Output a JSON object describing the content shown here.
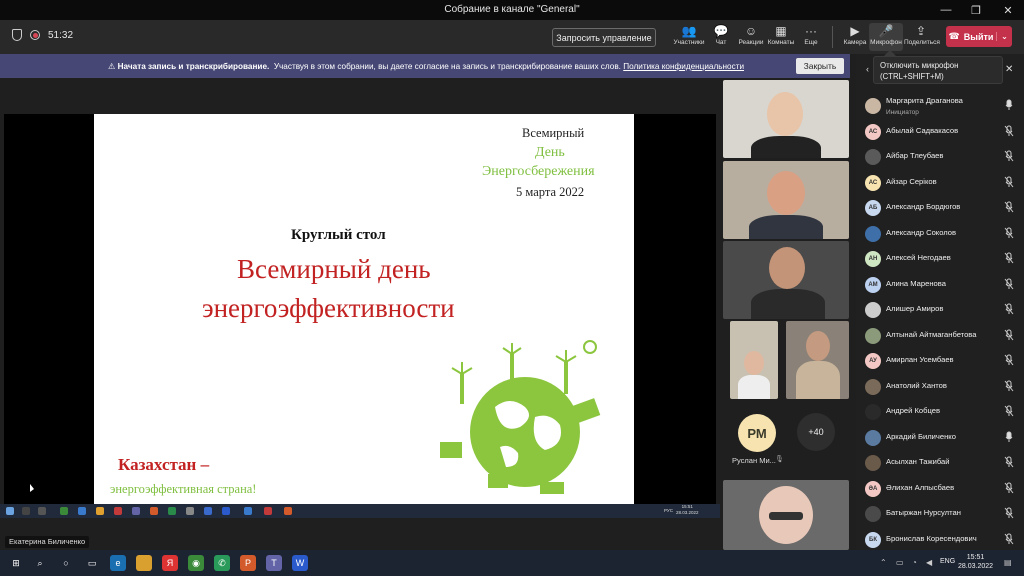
{
  "window": {
    "title": "Собрание в канале \"General\""
  },
  "toolbar": {
    "timer": "51:32",
    "request_control": "Запросить управление",
    "buttons": [
      {
        "label": "Участники",
        "icon": "people-icon"
      },
      {
        "label": "Чат",
        "icon": "chat-icon"
      },
      {
        "label": "Реакции",
        "icon": "reactions-icon"
      },
      {
        "label": "Комнаты",
        "icon": "rooms-icon"
      },
      {
        "label": "Еще",
        "icon": "more-icon"
      },
      {
        "label": "Камера",
        "icon": "camera-icon"
      },
      {
        "label": "Микрофон",
        "icon": "mic-icon"
      },
      {
        "label": "Поделиться",
        "icon": "share-icon"
      }
    ],
    "leave": "Выйти"
  },
  "notice": {
    "bold": "Начата запись и транскрибирование.",
    "text": "Участвуя в этом собрании, вы даете согласие на запись и транскрибирование ваших слов.",
    "link": "Политика конфиденциальности",
    "close": "Закрыть"
  },
  "tooltip": {
    "line1": "Отключить микрофон",
    "line2": "(CTRL+SHIFT+M)"
  },
  "slide": {
    "top1": "Всемирный",
    "top2": "День",
    "top3": "Энергосбережения",
    "top4": "5 марта 2022",
    "round": "Круглый стол",
    "main1": "Всемирный день",
    "main2": "энергоэффективности",
    "kz": "Казахстан –",
    "kz2": "энергоэффективная страна!"
  },
  "shared_taskbar": {
    "lang": "РУС",
    "time": "15:51",
    "date": "28.03.2022"
  },
  "speaker": "Екатерина Биличенко",
  "video": {
    "rm_initials": "РМ",
    "rm_name": "Руслан Ми...",
    "more": "+40"
  },
  "participants": [
    {
      "name": "Маргарита Драганова",
      "role": "Инициатор",
      "initials": "",
      "color": "#c9b7a4",
      "muted": false
    },
    {
      "name": "Абылай Садвакасов",
      "initials": "АС",
      "color": "#f3c8c4",
      "muted": true
    },
    {
      "name": "Айбар Тлеубаев",
      "initials": "",
      "color": "#5a5a5a",
      "muted": true
    },
    {
      "name": "Айзар Серіков",
      "initials": "АС",
      "color": "#f6e3b0",
      "muted": true
    },
    {
      "name": "Александр Бордюгов",
      "initials": "АБ",
      "color": "#c7d8ef",
      "muted": true
    },
    {
      "name": "Александр Соколов",
      "initials": "",
      "color": "#3f6fa8",
      "muted": true
    },
    {
      "name": "Алексей Негодаев",
      "initials": "АН",
      "color": "#cfe6c2",
      "muted": true
    },
    {
      "name": "Алина Маренова",
      "initials": "АМ",
      "color": "#bcd0f0",
      "muted": true
    },
    {
      "name": "Алишер Амиров",
      "initials": "",
      "color": "#cccccc",
      "muted": true
    },
    {
      "name": "Алтынай Айтмаганбетова",
      "initials": "",
      "color": "#8a9a7a",
      "muted": true
    },
    {
      "name": "Амирлан Усембаев",
      "initials": "АУ",
      "color": "#f3c8c4",
      "muted": true
    },
    {
      "name": "Анатолий Хантов",
      "initials": "",
      "color": "#7a6a5a",
      "muted": true
    },
    {
      "name": "Андрей Кобцев",
      "initials": "",
      "color": "#2a2a2a",
      "muted": true
    },
    {
      "name": "Аркадий Биличенко",
      "initials": "",
      "color": "#5a7aa0",
      "muted": false
    },
    {
      "name": "Асылхан Тажибай",
      "initials": "",
      "color": "#6a5a4a",
      "muted": true
    },
    {
      "name": "Әлихан Алпысбаев",
      "initials": "ӘА",
      "color": "#f3c8c4",
      "muted": true
    },
    {
      "name": "Батыржан Нурсултан",
      "initials": "",
      "color": "#4a4a4a",
      "muted": true
    },
    {
      "name": "Бронислав Коресендович",
      "initials": "БК",
      "color": "#c7d8ef",
      "muted": true
    }
  ],
  "taskbar": {
    "lang": "ENG",
    "time": "15:51",
    "date": "28.03.2022"
  }
}
